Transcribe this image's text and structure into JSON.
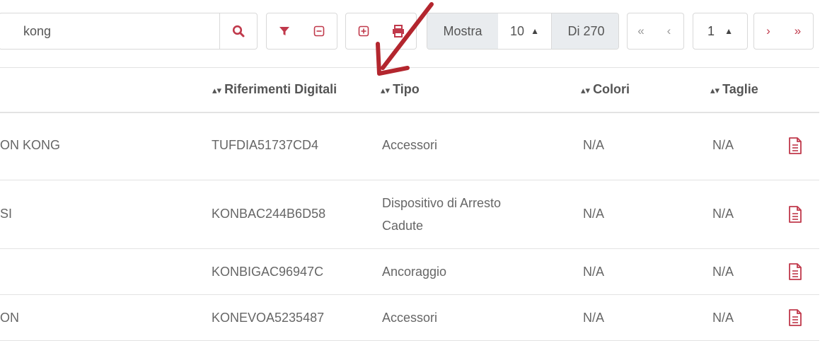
{
  "toolbar": {
    "search": {
      "value": "kong",
      "placeholder": ""
    },
    "search_icon": "search-icon",
    "filter_icon": "filter-icon",
    "collapse_icon": "minus-square-icon",
    "expand_icon": "plus-square-icon",
    "print_icon": "print-icon",
    "page_size": {
      "show_label": "Mostra",
      "selected": "10",
      "total_label": "Di 270"
    },
    "pagination": {
      "first": "«",
      "prev": "‹",
      "current_page": "1",
      "next": "›",
      "last": "»"
    },
    "accent_color": "#c0394b"
  },
  "table": {
    "columns": [
      {
        "key": "riferimenti",
        "label": "Riferimenti Digitali",
        "sort_icon": "sort-icon"
      },
      {
        "key": "tipo",
        "label": "Tipo",
        "sort_icon": "sort-icon"
      },
      {
        "key": "colori",
        "label": "Colori",
        "sort_icon": "sort-icon"
      },
      {
        "key": "taglie",
        "label": "Taglie",
        "sort_icon": "sort-icon"
      }
    ],
    "rows": [
      {
        "name": "ON KONG",
        "ref": "TUFDIA51737CD4",
        "tipo": "Accessori",
        "colori": "N/A",
        "taglie": "N/A"
      },
      {
        "name": "SI",
        "ref": "KONBAC244B6D58",
        "tipo": "Dispositivo di Arresto Cadute",
        "colori": "N/A",
        "taglie": "N/A"
      },
      {
        "name": "",
        "ref": "KONBIGAC96947C",
        "tipo": "Ancoraggio",
        "colori": "N/A",
        "taglie": "N/A"
      },
      {
        "name": "ON",
        "ref": "KONEVOA5235487",
        "tipo": "Accessori",
        "colori": "N/A",
        "taglie": "N/A"
      }
    ],
    "row_action_icon": "pdf-document-icon"
  },
  "annotation": {
    "arrow_color": "#b3262e",
    "arrow_icon": "red-arrow-annotation"
  }
}
